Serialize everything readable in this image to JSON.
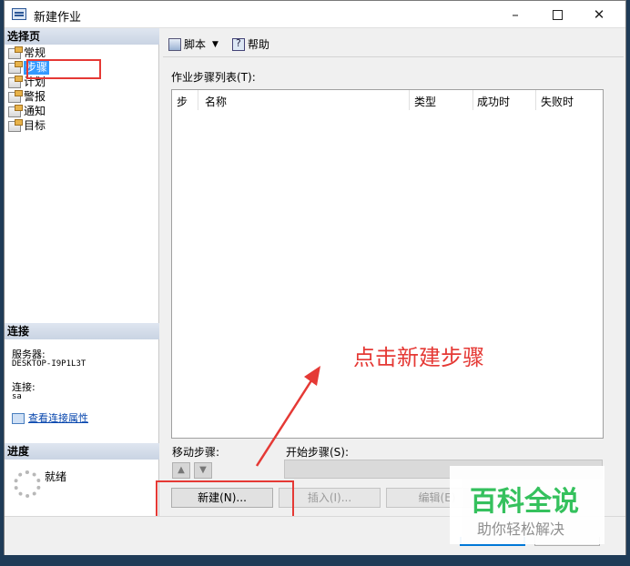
{
  "window": {
    "title": "新建作业",
    "min_label": "–",
    "close_label": "✕"
  },
  "left": {
    "select_page_header": "选择页",
    "pages": [
      {
        "label": "常规"
      },
      {
        "label": "步骤",
        "selected": true
      },
      {
        "label": "计划"
      },
      {
        "label": "警报"
      },
      {
        "label": "通知"
      },
      {
        "label": "目标"
      }
    ],
    "connection_header": "连接",
    "server_label": "服务器:",
    "server_value": "DESKTOP-I9P1L3T",
    "connection_label": "连接:",
    "connection_value": "sa",
    "view_properties_link": "查看连接属性",
    "progress_header": "进度",
    "progress_status": "就绪"
  },
  "toolbar": {
    "script_label": "脚本",
    "dropdown_glyph": "▼",
    "help_label": "帮助"
  },
  "steps": {
    "list_caption": "作业步骤列表(T):",
    "columns": [
      "步",
      "名称",
      "类型",
      "成功时",
      "失败时"
    ],
    "move_step_label": "移动步骤:",
    "up_glyph": "▲",
    "down_glyph": "▼",
    "start_step_label": "开始步骤(S):",
    "start_step_value": ""
  },
  "buttons": {
    "new": "新建(N)...",
    "insert": "插入(I)...",
    "edit": "编辑(E)"
  },
  "annotation": {
    "text": "点击新建步骤",
    "color": "#e53935"
  },
  "watermark": {
    "title": "百科全说",
    "subtitle": "助你轻松解决"
  },
  "colors": {
    "selection": "#3399ff",
    "link": "#0645ad",
    "watermark_green": "#2bbf56",
    "highlight_red": "#e53935"
  }
}
